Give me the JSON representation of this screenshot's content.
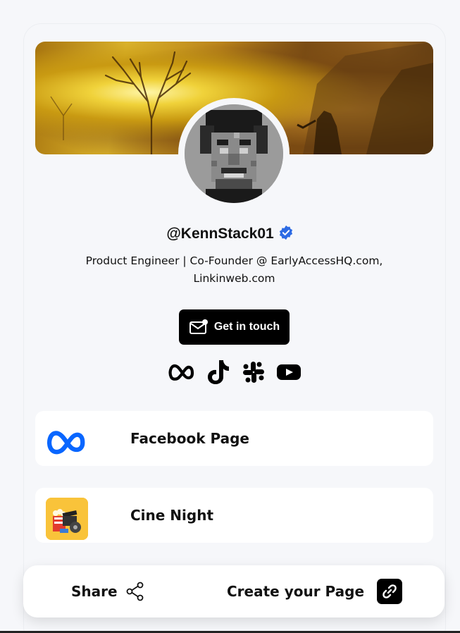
{
  "profile": {
    "handle": "@KennStack01",
    "verified_icon": "verified-badge-icon",
    "bio": "Product Engineer | Co-Founder @ EarlyAccessHQ.com, Linkinweb.com"
  },
  "contact": {
    "label": "Get in touch",
    "icon": "mail-icon"
  },
  "socials": [
    "meta-icon",
    "tiktok-icon",
    "slack-icon",
    "youtube-icon"
  ],
  "links": [
    {
      "label": "Facebook Page",
      "icon": "meta-logo-icon"
    },
    {
      "label": "Cine Night",
      "icon": "cinema-thumbnail"
    }
  ],
  "footer": {
    "share_label": "Share",
    "create_label": "Create your Page"
  },
  "colors": {
    "accent_blue": "#0866ff",
    "verified_blue": "#2d6be4",
    "button_bg": "#000000"
  }
}
